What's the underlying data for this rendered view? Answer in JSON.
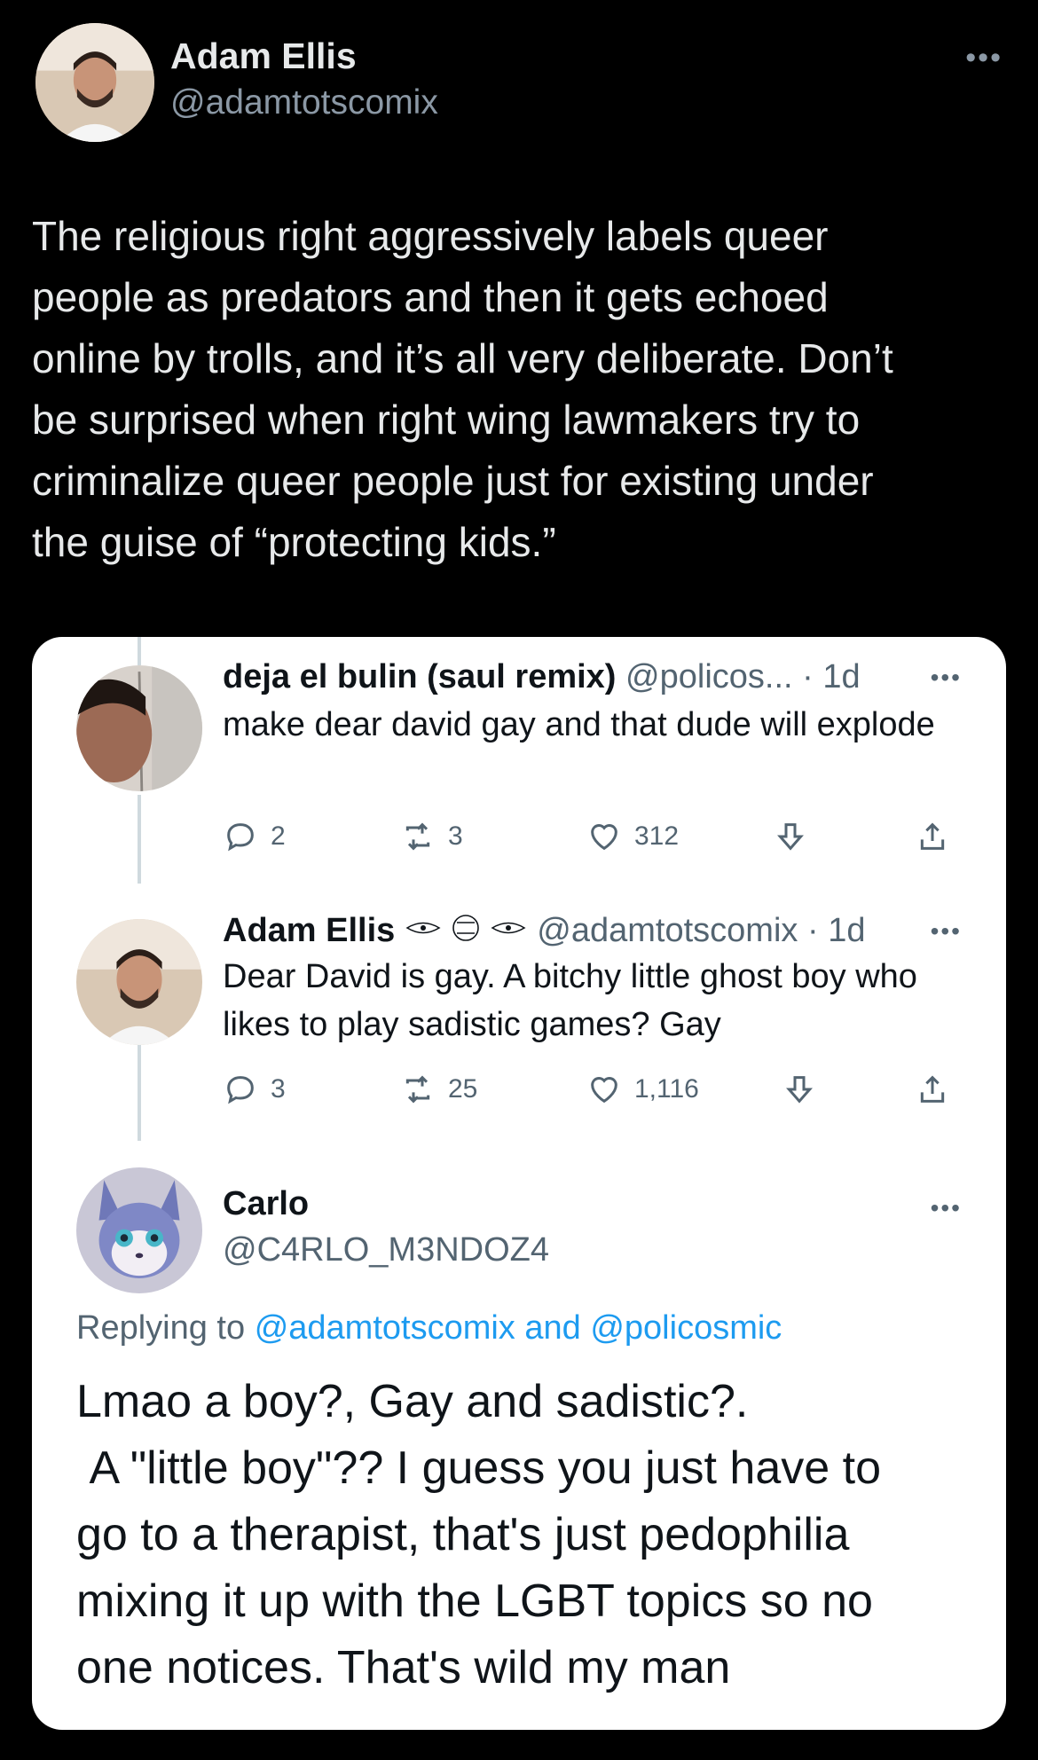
{
  "tweet": {
    "author_name": "Adam Ellis",
    "author_handle": "@adamtotscomix",
    "more": "•••",
    "text": "The religious right aggressively labels queer\npeople as predators and then it gets echoed\nonline by trolls, and it’s all very deliberate. Don’t\nbe surprised when right wing lawmakers try to\ncriminalize queer people just for existing under\nthe guise of “protecting kids.”"
  },
  "embed": {
    "replies": [
      {
        "name": "deja el bulin (saul remix)",
        "handle": "@policos...",
        "time": "· 1d",
        "more": "•••",
        "text": "make dear david gay and that dude will explode",
        "replies": "2",
        "retweets": "3",
        "likes": "312"
      },
      {
        "name": "Adam Ellis",
        "handle": "@adamtotscomix",
        "time": "· 1d",
        "more": "•••",
        "text": "Dear David is gay. A bitchy little ghost boy who likes to play sadistic games? Gay",
        "replies": "3",
        "retweets": "25",
        "likes": "1,116"
      }
    ],
    "main_reply": {
      "name": "Carlo",
      "handle": "@C4RLO_M3NDOZ4",
      "more": "•••",
      "replying_prefix": "Replying to",
      "replying_user1": "@adamtotscomix",
      "replying_and": "and",
      "replying_user2": "@policosmic",
      "text": "Lmao a boy?, Gay and sadistic?.\n A \"little boy\"?? I guess you just have to\ngo to a therapist, that's just pedophilia\nmixing it up with the LGBT topics so no\none notices. That's wild my man"
    }
  },
  "icons": {
    "reply": "reply-icon",
    "retweet": "retweet-icon",
    "like": "heart-icon",
    "bookmark": "bookmark-arrow-icon",
    "share": "share-icon"
  },
  "colors": {
    "background": "#000000",
    "card": "#ffffff",
    "link": "#1d9bf0",
    "muted_dark": "#8b98a5",
    "muted_light": "#536471"
  }
}
